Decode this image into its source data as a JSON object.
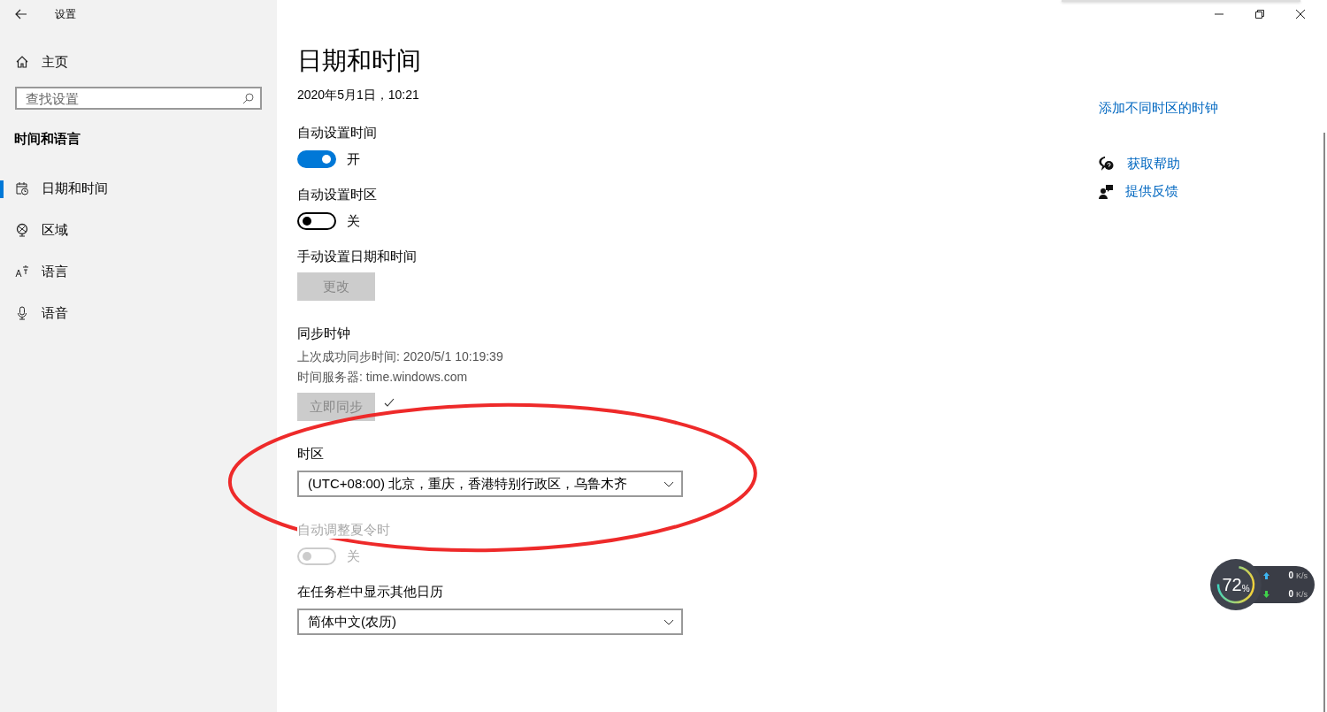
{
  "window": {
    "title": "设置"
  },
  "sidebar": {
    "home": "主页",
    "search": {
      "placeholder": "查找设置"
    },
    "section": "时间和语言",
    "items": [
      {
        "label": "日期和时间",
        "selected": true
      },
      {
        "label": "区域",
        "selected": false
      },
      {
        "label": "语言",
        "selected": false
      },
      {
        "label": "语音",
        "selected": false
      }
    ]
  },
  "page": {
    "title": "日期和时间",
    "datetime": "2020年5月1日，10:21"
  },
  "auto_time": {
    "label": "自动设置时间",
    "on": true,
    "state_text": "开"
  },
  "auto_timezone": {
    "label": "自动设置时区",
    "on": false,
    "state_text": "关"
  },
  "manual": {
    "label": "手动设置日期和时间",
    "button": {
      "label": "更改",
      "disabled": true
    }
  },
  "sync": {
    "label": "同步时钟",
    "last_sync": "上次成功同步时间: 2020/5/1 10:19:39",
    "server": "时间服务器: time.windows.com",
    "button": {
      "label": "立即同步",
      "disabled": true
    }
  },
  "timezone": {
    "label": "时区",
    "value": "(UTC+08:00) 北京，重庆，香港特别行政区，乌鲁木齐"
  },
  "dst": {
    "label": "自动调整夏令时",
    "on": false,
    "state_text": "关",
    "disabled": true
  },
  "calendar": {
    "label": "在任务栏中显示其他日历",
    "value": "简体中文(农历)"
  },
  "related": {
    "link": "添加不同时区的时钟"
  },
  "help": [
    {
      "label": "获取帮助"
    },
    {
      "label": "提供反馈"
    }
  ],
  "meter": {
    "percent": "72",
    "unit": "%",
    "upload": {
      "value": "0",
      "unit": "K/s"
    },
    "download": {
      "value": "0",
      "unit": "K/s"
    }
  }
}
